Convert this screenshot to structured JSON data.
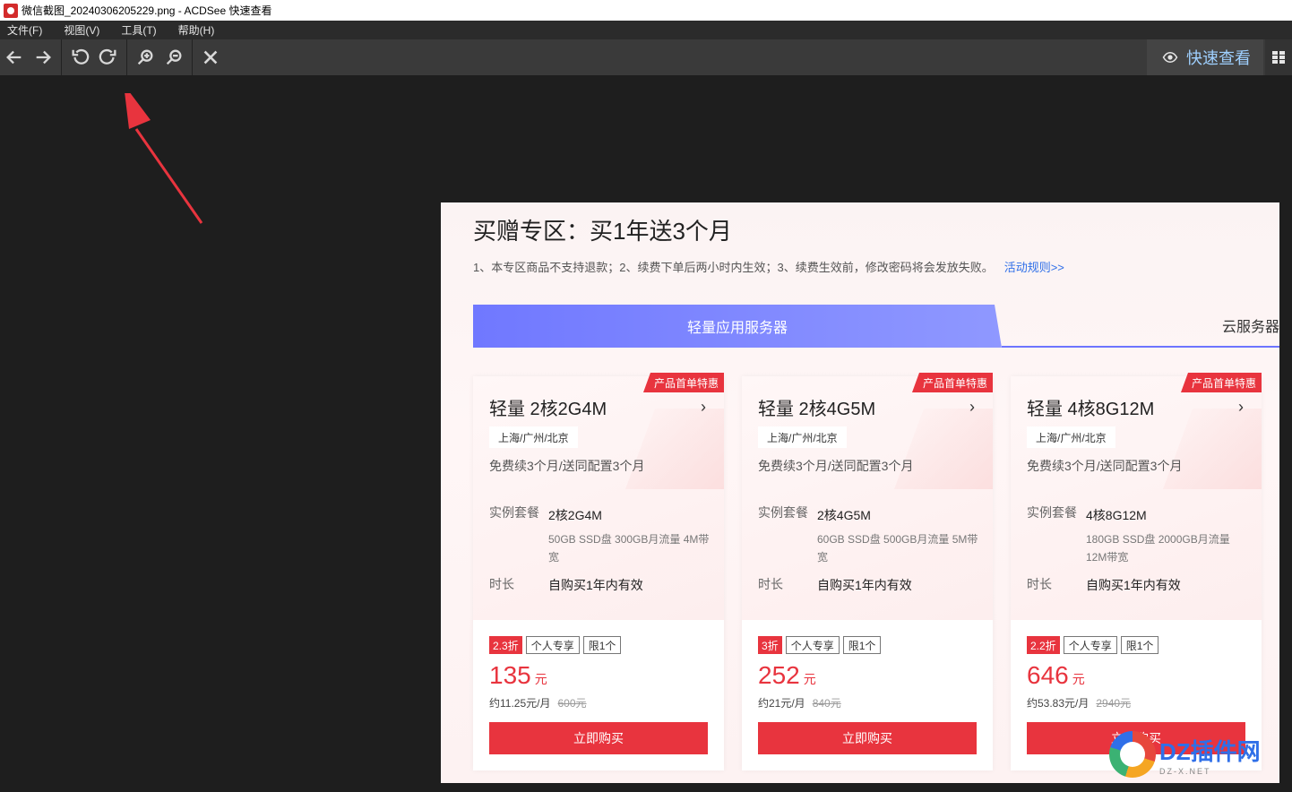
{
  "window": {
    "title": "微信截图_20240306205229.png - ACDSee 快速查看"
  },
  "menu": [
    "文件(F)",
    "视图(V)",
    "工具(T)",
    "帮助(H)"
  ],
  "toolbar": {
    "quickview_label": "快速查看"
  },
  "panel": {
    "title": "买赠专区：买1年送3个月",
    "rules": "1、本专区商品不支持退款；2、续费下单后两小时内生效；3、续费生效前，修改密码将会发放失败。",
    "rules_link": "活动规则>>",
    "tabs": [
      "轻量应用服务器",
      "云服务器"
    ],
    "cards": [
      {
        "badge": "产品首单特惠",
        "name": "轻量 2核2G4M",
        "region": "上海/广州/北京",
        "renew": "免费续3个月/送同配置3个月",
        "spec_label": "实例套餐",
        "spec": "2核2G4M",
        "spec_detail": "50GB SSD盘 300GB月流量 4M带宽",
        "duration_label": "时长",
        "duration": "自购买1年内有效",
        "discount": "2.3折",
        "tag1": "个人专享",
        "tag2": "限1个",
        "price": "135",
        "price_unit": "元",
        "monthly": "约11.25元/月",
        "original": "600元",
        "buy": "立即购买"
      },
      {
        "badge": "产品首单特惠",
        "name": "轻量 2核4G5M",
        "region": "上海/广州/北京",
        "renew": "免费续3个月/送同配置3个月",
        "spec_label": "实例套餐",
        "spec": "2核4G5M",
        "spec_detail": "60GB SSD盘 500GB月流量 5M带宽",
        "duration_label": "时长",
        "duration": "自购买1年内有效",
        "discount": "3折",
        "tag1": "个人专享",
        "tag2": "限1个",
        "price": "252",
        "price_unit": "元",
        "monthly": "约21元/月",
        "original": "840元",
        "buy": "立即购买"
      },
      {
        "badge": "产品首单特惠",
        "name": "轻量 4核8G12M",
        "region": "上海/广州/北京",
        "renew": "免费续3个月/送同配置3个月",
        "spec_label": "实例套餐",
        "spec": "4核8G12M",
        "spec_detail": "180GB SSD盘 2000GB月流量 12M带宽",
        "duration_label": "时长",
        "duration": "自购买1年内有效",
        "discount": "2.2折",
        "tag1": "个人专享",
        "tag2": "限1个",
        "price": "646",
        "price_unit": "元",
        "monthly": "约53.83元/月",
        "original": "2940元",
        "buy": "立即购买"
      }
    ]
  },
  "watermark": {
    "main": "DZ插件网",
    "sub": "DZ-X.NET"
  },
  "colors": {
    "accent_red": "#e8343e",
    "tab_blue": "#7078ff",
    "link_blue": "#2f6fe8"
  }
}
